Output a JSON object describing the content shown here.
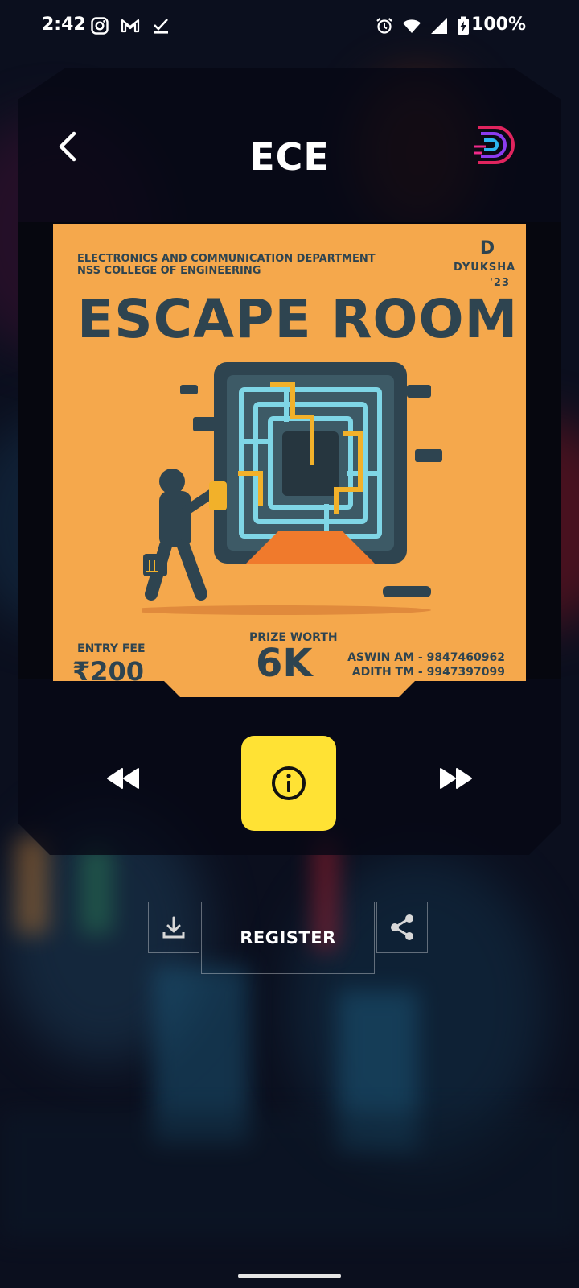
{
  "status_bar": {
    "time": "2:42",
    "battery": "100%",
    "left_icons": [
      "instagram-icon",
      "gmail-icon",
      "download-done-icon"
    ],
    "right_icons": [
      "alarm-icon",
      "wifi-icon",
      "signal-icon",
      "battery-charging-icon"
    ]
  },
  "header": {
    "title": "ECE",
    "back_icon": "chevron-left-icon",
    "logo_icon": "dyuksha-logo"
  },
  "poster": {
    "department_line1": "ELECTRONICS AND COMMUNICATION DEPARTMENT",
    "department_line2": "NSS COLLEGE OF ENGINEERING",
    "brand": "DYUKSHA '23",
    "brand_mark": "D",
    "event_title": "ESCAPE ROOM",
    "entry_fee_label": "ENTRY FEE",
    "entry_fee_value": "₹200",
    "prize_label": "PRIZE WORTH",
    "prize_value": "6K",
    "contact_1": "ASWIN AM - 9847460962",
    "contact_2": "ADITH TM - 9947397099",
    "colors": {
      "background": "#f5a84c",
      "text": "#2e4450"
    }
  },
  "controls": {
    "prev_icon": "rewind-icon",
    "info_icon": "info-icon",
    "next_icon": "fast-forward-icon",
    "info_color": "#ffe234"
  },
  "actions": {
    "download_icon": "download-icon",
    "register_label": "REGISTER",
    "share_icon": "share-icon"
  }
}
